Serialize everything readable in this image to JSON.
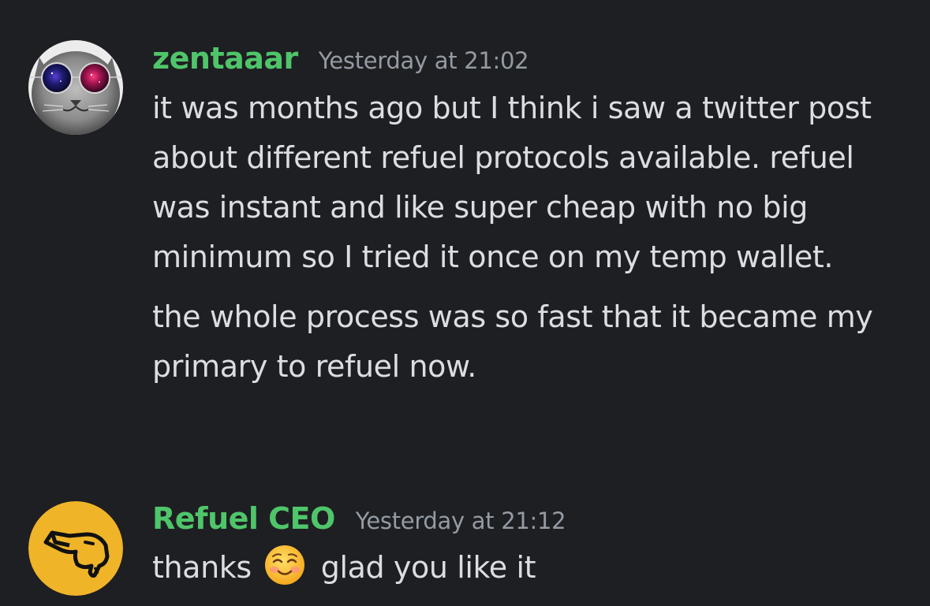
{
  "messages": [
    {
      "username": "zentaaar",
      "username_color": "#4fc56a",
      "timestamp": "Yesterday at 21:02",
      "avatar_icon": "cat-with-galaxy-glasses-icon",
      "paragraphs": [
        "it was months ago but I think i saw a twitter post about different refuel protocols available. refuel was instant and like super cheap with no big minimum so I tried it once on my temp wallet.",
        "the whole process was so fast that it became my primary to refuel now."
      ]
    },
    {
      "username": "Refuel CEO",
      "username_color": "#4fc56a",
      "timestamp": "Yesterday at 21:12",
      "avatar_icon": "panther-logo-icon",
      "avatar_bg": "#f0b429",
      "text_before_emoji": "thanks",
      "emoji": "smiling-face-icon",
      "text_after_emoji": "glad you like it"
    }
  ],
  "colors": {
    "background": "#1e1f22",
    "text": "#dbdee1",
    "muted": "#949ba4",
    "accent_green": "#4fc56a"
  }
}
